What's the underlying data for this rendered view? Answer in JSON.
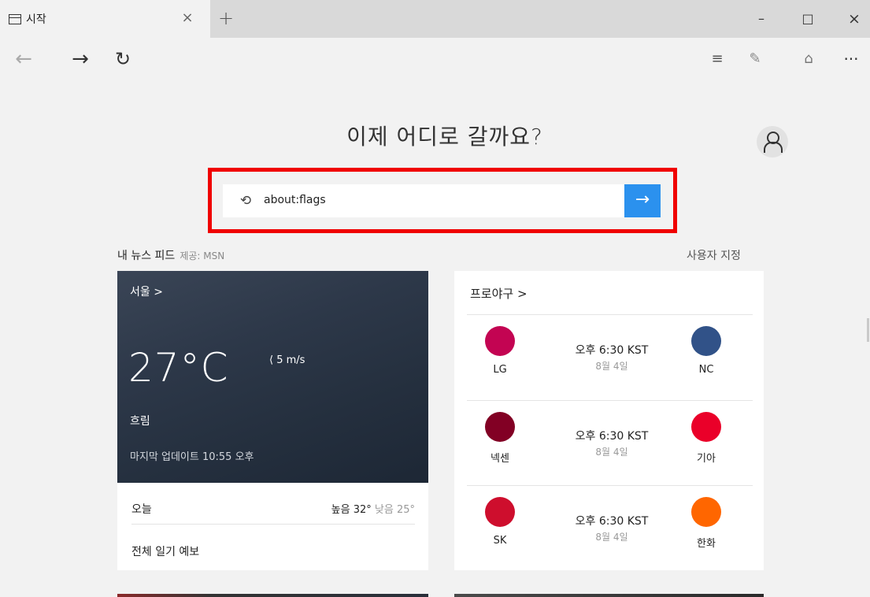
{
  "tab": {
    "title": "시작",
    "close_glyph": "×",
    "new_tab_glyph": "+"
  },
  "window": {
    "minimize_glyph": "–",
    "maximize_glyph": "□",
    "close_glyph": "×"
  },
  "nav": {
    "back_glyph": "←",
    "forward_glyph": "→",
    "refresh_glyph": "↻"
  },
  "toolbar": {
    "hub_glyph": "≡",
    "note_glyph": "✎",
    "share_glyph": "⌂",
    "more_glyph": "···"
  },
  "page": {
    "heading": "이제 어디로 갈까요?",
    "search": {
      "history_glyph": "⟲",
      "value": "about:flags",
      "go_glyph": "→"
    },
    "feed": {
      "title": "내 뉴스 피드",
      "provider": "제공: MSN",
      "customize": "사용자 지정"
    }
  },
  "weather": {
    "city": "서울 >",
    "temperature": "27°C",
    "wind": "⟨ 5 m/s",
    "condition": "흐림",
    "updated": "마지막 업데이트 10:55 오후",
    "today_label": "오늘",
    "high": "높음 32°",
    "low": "낮음 25°",
    "forecast_link": "전체 일기 예보"
  },
  "baseball": {
    "title": "프로야구 >",
    "games": [
      {
        "home": "LG",
        "away": "NC",
        "time": "오후 6:30 KST",
        "date": "8월 4일",
        "home_color": "#c30452",
        "away_color": "#315288"
      },
      {
        "home": "넥센",
        "away": "기아",
        "time": "오후 6:30 KST",
        "date": "8월 4일",
        "home_color": "#820024",
        "away_color": "#ea0029"
      },
      {
        "home": "SK",
        "away": "한화",
        "time": "오후 6:30 KST",
        "date": "8월 4일",
        "home_color": "#ce0e2d",
        "away_color": "#ff6600"
      }
    ]
  },
  "colors": {
    "accent": "#2b91ee",
    "highlight": "#f00000",
    "weather_bg": "#2d3849"
  }
}
